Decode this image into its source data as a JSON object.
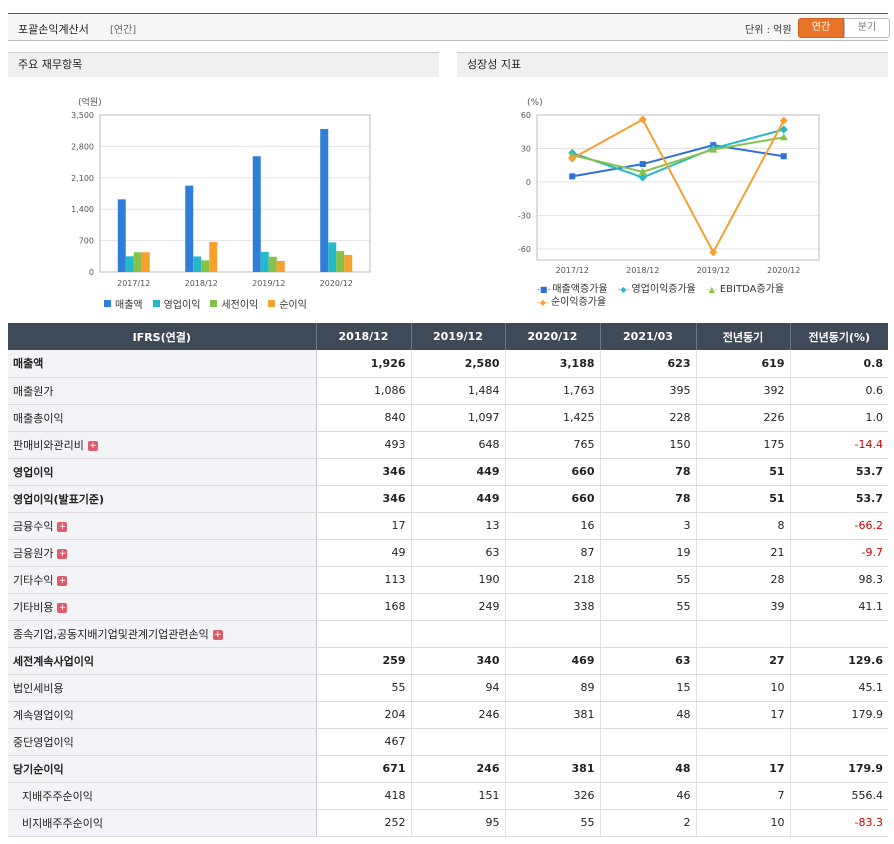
{
  "header": {
    "title": "포괄손익계산서",
    "subtitle": "[연간]",
    "unit_label": "단위 : 억원",
    "period_tabs": [
      "연간",
      "분기"
    ]
  },
  "panels": {
    "left_title": "주요 재무항목",
    "right_title": "성장성 지표"
  },
  "chart_data": [
    {
      "type": "bar",
      "title": "",
      "ylabel": "(억원)",
      "ylim": [
        0,
        3500
      ],
      "yticks": [
        "3,500",
        "2,800",
        "2,100",
        "1,400",
        "700",
        "0"
      ],
      "yticks_values": [
        3500,
        2800,
        2100,
        1400,
        700,
        0
      ],
      "categories": [
        "2017/12",
        "2018/12",
        "2019/12",
        "2020/12"
      ],
      "series": [
        {
          "name": "매출액",
          "color": "#2f7fd8",
          "values": [
            1620,
            1926,
            2580,
            3188
          ]
        },
        {
          "name": "영업이익",
          "color": "#25b8c9",
          "values": [
            350,
            346,
            449,
            660
          ]
        },
        {
          "name": "세전이익",
          "color": "#86c24a",
          "values": [
            440,
            259,
            340,
            469
          ]
        },
        {
          "name": "순이익",
          "color": "#f6a030",
          "values": [
            440,
            671,
            246,
            381
          ]
        }
      ],
      "grid": true,
      "legend": "bottom"
    },
    {
      "type": "line",
      "title": "",
      "ylabel": "(%)",
      "ylim": [
        -70,
        60
      ],
      "yticks": [
        "60",
        "30",
        "0",
        "-30",
        "-60"
      ],
      "yticks_values": [
        60,
        30,
        0,
        -30,
        -60
      ],
      "categories": [
        "2017/12",
        "2018/12",
        "2019/12",
        "2020/12"
      ],
      "series": [
        {
          "name": "매출액증가율",
          "color": "#2f6fd8",
          "marker": "square",
          "values": [
            5,
            16,
            33,
            23
          ]
        },
        {
          "name": "영업이익증가율",
          "color": "#25b8c9",
          "marker": "diamond",
          "values": [
            26,
            4,
            30,
            47
          ]
        },
        {
          "name": "EBITDA증가율",
          "color": "#86c24a",
          "marker": "triangle",
          "values": [
            24,
            9,
            29,
            40
          ]
        },
        {
          "name": "순이익증가율",
          "color": "#f6a030",
          "marker": "diamond",
          "values": [
            21,
            56,
            -63,
            55
          ]
        }
      ],
      "grid": true,
      "legend": "bottom"
    }
  ],
  "table": {
    "headers": [
      "IFRS(연결)",
      "2018/12",
      "2019/12",
      "2020/12",
      "2021/03",
      "전년동기",
      "전년동기(%)"
    ],
    "rows": [
      {
        "label": "매출액",
        "bold": true,
        "plus": false,
        "indent": false,
        "cells": [
          "1,926",
          "2,580",
          "3,188",
          "623",
          "619",
          "0.8"
        ],
        "neg": false
      },
      {
        "label": "매출원가",
        "bold": false,
        "plus": false,
        "indent": false,
        "cells": [
          "1,086",
          "1,484",
          "1,763",
          "395",
          "392",
          "0.6"
        ],
        "neg": false
      },
      {
        "label": "매출총이익",
        "bold": false,
        "plus": false,
        "indent": false,
        "cells": [
          "840",
          "1,097",
          "1,425",
          "228",
          "226",
          "1.0"
        ],
        "neg": false
      },
      {
        "label": "판매비와관리비",
        "bold": false,
        "plus": true,
        "indent": false,
        "cells": [
          "493",
          "648",
          "765",
          "150",
          "175",
          "-14.4"
        ],
        "neg": true
      },
      {
        "label": "영업이익",
        "bold": true,
        "plus": false,
        "indent": false,
        "cells": [
          "346",
          "449",
          "660",
          "78",
          "51",
          "53.7"
        ],
        "neg": false
      },
      {
        "label": "영업이익(발표기준)",
        "bold": true,
        "plus": false,
        "indent": false,
        "cells": [
          "346",
          "449",
          "660",
          "78",
          "51",
          "53.7"
        ],
        "neg": false
      },
      {
        "label": "금융수익",
        "bold": false,
        "plus": true,
        "indent": false,
        "cells": [
          "17",
          "13",
          "16",
          "3",
          "8",
          "-66.2"
        ],
        "neg": true
      },
      {
        "label": "금융원가",
        "bold": false,
        "plus": true,
        "indent": false,
        "cells": [
          "49",
          "63",
          "87",
          "19",
          "21",
          "-9.7"
        ],
        "neg": true
      },
      {
        "label": "기타수익",
        "bold": false,
        "plus": true,
        "indent": false,
        "cells": [
          "113",
          "190",
          "218",
          "55",
          "28",
          "98.3"
        ],
        "neg": false
      },
      {
        "label": "기타비용",
        "bold": false,
        "plus": true,
        "indent": false,
        "cells": [
          "168",
          "249",
          "338",
          "55",
          "39",
          "41.1"
        ],
        "neg": false
      },
      {
        "label": "종속기업,공동지배기업및관계기업관련손익",
        "bold": false,
        "plus": true,
        "indent": false,
        "cells": [
          "",
          "",
          "",
          "",
          "",
          ""
        ],
        "neg": false
      },
      {
        "label": "세전계속사업이익",
        "bold": true,
        "plus": false,
        "indent": false,
        "cells": [
          "259",
          "340",
          "469",
          "63",
          "27",
          "129.6"
        ],
        "neg": false
      },
      {
        "label": "법인세비용",
        "bold": false,
        "plus": false,
        "indent": false,
        "cells": [
          "55",
          "94",
          "89",
          "15",
          "10",
          "45.1"
        ],
        "neg": false
      },
      {
        "label": "계속영업이익",
        "bold": false,
        "plus": false,
        "indent": false,
        "cells": [
          "204",
          "246",
          "381",
          "48",
          "17",
          "179.9"
        ],
        "neg": false
      },
      {
        "label": "중단영업이익",
        "bold": false,
        "plus": false,
        "indent": false,
        "cells": [
          "467",
          "",
          "",
          "",
          "",
          ""
        ],
        "neg": false
      },
      {
        "label": "당기순이익",
        "bold": true,
        "plus": false,
        "indent": false,
        "cells": [
          "671",
          "246",
          "381",
          "48",
          "17",
          "179.9"
        ],
        "neg": false
      },
      {
        "label": "지배주주순이익",
        "bold": false,
        "plus": false,
        "indent": true,
        "cells": [
          "418",
          "151",
          "326",
          "46",
          "7",
          "556.4"
        ],
        "neg": false
      },
      {
        "label": "비지배주주순이익",
        "bold": false,
        "plus": false,
        "indent": true,
        "cells": [
          "252",
          "95",
          "55",
          "2",
          "10",
          "-83.3"
        ],
        "neg": true
      }
    ]
  }
}
